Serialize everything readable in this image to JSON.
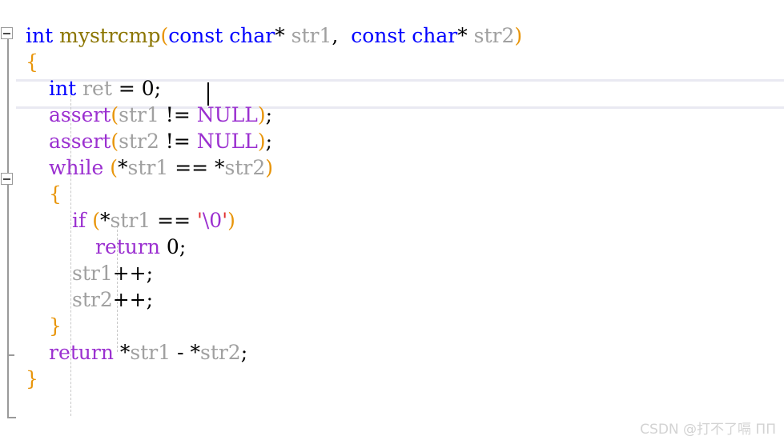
{
  "editor": {
    "app": "visual-studio-code-editor",
    "language": "c",
    "background_color": "#ffffff",
    "current_line_number": 3,
    "current_line_highlight_color": "#e9e9f2",
    "indent_guide_color": "#c8c8c8",
    "fold_line_color": "#9a9a9a"
  },
  "palette": {
    "keyword": "#0000ff",
    "function_name": "#8b7500",
    "bracket": "#e8950a",
    "identifier": "#a0a0a0",
    "operator": "#000000",
    "macro_control": "#9b30d0",
    "string_quote": "#e03030",
    "escape_sequence": "#9b30d0",
    "number": "#000000"
  },
  "code": {
    "lines": [
      {
        "index": 1,
        "indent": 0,
        "text": "int mystrcmp(const char* str1, const char* str2)",
        "tokens": [
          {
            "text": "int",
            "type": "keyword"
          },
          {
            "text": " ",
            "type": "plain"
          },
          {
            "text": "mystrcmp",
            "type": "function_name"
          },
          {
            "text": "(",
            "type": "bracket"
          },
          {
            "text": "const",
            "type": "keyword"
          },
          {
            "text": " ",
            "type": "plain"
          },
          {
            "text": "char",
            "type": "keyword"
          },
          {
            "text": "*",
            "type": "operator"
          },
          {
            "text": " ",
            "type": "plain"
          },
          {
            "text": "str1",
            "type": "identifier"
          },
          {
            "text": ",",
            "type": "operator"
          },
          {
            "text": "  ",
            "type": "plain"
          },
          {
            "text": "const",
            "type": "keyword"
          },
          {
            "text": " ",
            "type": "plain"
          },
          {
            "text": "char",
            "type": "keyword"
          },
          {
            "text": "*",
            "type": "operator"
          },
          {
            "text": " ",
            "type": "plain"
          },
          {
            "text": "str2",
            "type": "identifier"
          },
          {
            "text": ")",
            "type": "bracket"
          }
        ]
      },
      {
        "index": 2,
        "indent": 0,
        "text": "{",
        "tokens": [
          {
            "text": "{",
            "type": "bracket"
          }
        ]
      },
      {
        "index": 3,
        "indent": 1,
        "text": "int ret = 0;",
        "tokens": [
          {
            "text": "int",
            "type": "keyword"
          },
          {
            "text": " ",
            "type": "plain"
          },
          {
            "text": "ret",
            "type": "identifier"
          },
          {
            "text": " = ",
            "type": "operator"
          },
          {
            "text": "0",
            "type": "number"
          },
          {
            "text": ";",
            "type": "operator"
          }
        ]
      },
      {
        "index": 4,
        "indent": 1,
        "text": "assert(str1 != NULL);",
        "tokens": [
          {
            "text": "assert",
            "type": "macro_control"
          },
          {
            "text": "(",
            "type": "bracket"
          },
          {
            "text": "str1",
            "type": "identifier"
          },
          {
            "text": " != ",
            "type": "operator"
          },
          {
            "text": "NULL",
            "type": "macro_control"
          },
          {
            "text": ")",
            "type": "bracket"
          },
          {
            "text": ";",
            "type": "operator"
          }
        ]
      },
      {
        "index": 5,
        "indent": 1,
        "text": "assert(str2 != NULL);",
        "tokens": [
          {
            "text": "assert",
            "type": "macro_control"
          },
          {
            "text": "(",
            "type": "bracket"
          },
          {
            "text": "str2",
            "type": "identifier"
          },
          {
            "text": " != ",
            "type": "operator"
          },
          {
            "text": "NULL",
            "type": "macro_control"
          },
          {
            "text": ")",
            "type": "bracket"
          },
          {
            "text": ";",
            "type": "operator"
          }
        ]
      },
      {
        "index": 6,
        "indent": 1,
        "text": "while (*str1 == *str2)",
        "tokens": [
          {
            "text": "while",
            "type": "macro_control"
          },
          {
            "text": " ",
            "type": "plain"
          },
          {
            "text": "(",
            "type": "bracket"
          },
          {
            "text": "*",
            "type": "operator"
          },
          {
            "text": "str1",
            "type": "identifier"
          },
          {
            "text": " == ",
            "type": "operator"
          },
          {
            "text": "*",
            "type": "operator"
          },
          {
            "text": "str2",
            "type": "identifier"
          },
          {
            "text": ")",
            "type": "bracket"
          }
        ]
      },
      {
        "index": 7,
        "indent": 1,
        "text": "{",
        "tokens": [
          {
            "text": "{",
            "type": "bracket"
          }
        ]
      },
      {
        "index": 8,
        "indent": 2,
        "text": "if (*str1 == '\\0')",
        "tokens": [
          {
            "text": "if",
            "type": "macro_control"
          },
          {
            "text": " ",
            "type": "plain"
          },
          {
            "text": "(",
            "type": "bracket"
          },
          {
            "text": "*",
            "type": "operator"
          },
          {
            "text": "str1",
            "type": "identifier"
          },
          {
            "text": " == ",
            "type": "operator"
          },
          {
            "text": "'",
            "type": "string_quote"
          },
          {
            "text": "\\0",
            "type": "escape_sequence"
          },
          {
            "text": "'",
            "type": "string_quote"
          },
          {
            "text": ")",
            "type": "bracket"
          }
        ]
      },
      {
        "index": 9,
        "indent": 3,
        "text": "return 0;",
        "tokens": [
          {
            "text": "return",
            "type": "macro_control"
          },
          {
            "text": " ",
            "type": "plain"
          },
          {
            "text": "0",
            "type": "number"
          },
          {
            "text": ";",
            "type": "operator"
          }
        ]
      },
      {
        "index": 10,
        "indent": 2,
        "text": "str1++;",
        "tokens": [
          {
            "text": "str1",
            "type": "identifier"
          },
          {
            "text": "++;",
            "type": "operator"
          }
        ]
      },
      {
        "index": 11,
        "indent": 2,
        "text": "str2++;",
        "tokens": [
          {
            "text": "str2",
            "type": "identifier"
          },
          {
            "text": "++;",
            "type": "operator"
          }
        ]
      },
      {
        "index": 12,
        "indent": 1,
        "text": "}",
        "tokens": [
          {
            "text": "}",
            "type": "bracket"
          }
        ]
      },
      {
        "index": 13,
        "indent": 1,
        "text": "return *str1 - *str2;",
        "tokens": [
          {
            "text": "return",
            "type": "macro_control"
          },
          {
            "text": " ",
            "type": "plain"
          },
          {
            "text": "*",
            "type": "operator"
          },
          {
            "text": "str1",
            "type": "identifier"
          },
          {
            "text": " - ",
            "type": "operator"
          },
          {
            "text": "*",
            "type": "operator"
          },
          {
            "text": "str2",
            "type": "identifier"
          },
          {
            "text": ";",
            "type": "operator"
          }
        ]
      },
      {
        "index": 14,
        "indent": 0,
        "text": "}",
        "tokens": [
          {
            "text": "}",
            "type": "bracket"
          }
        ]
      }
    ]
  },
  "gutter": {
    "fold_markers": [
      {
        "name": "fold-toggle-function",
        "line": 1,
        "state": "expanded",
        "glyph": "minus"
      },
      {
        "name": "fold-toggle-while",
        "line": 6,
        "state": "expanded",
        "glyph": "minus"
      }
    ]
  },
  "caret": {
    "visible": true,
    "line": 3,
    "column": 13
  },
  "watermark": {
    "text": "CSDN @打不了嗝 ПΠ"
  }
}
